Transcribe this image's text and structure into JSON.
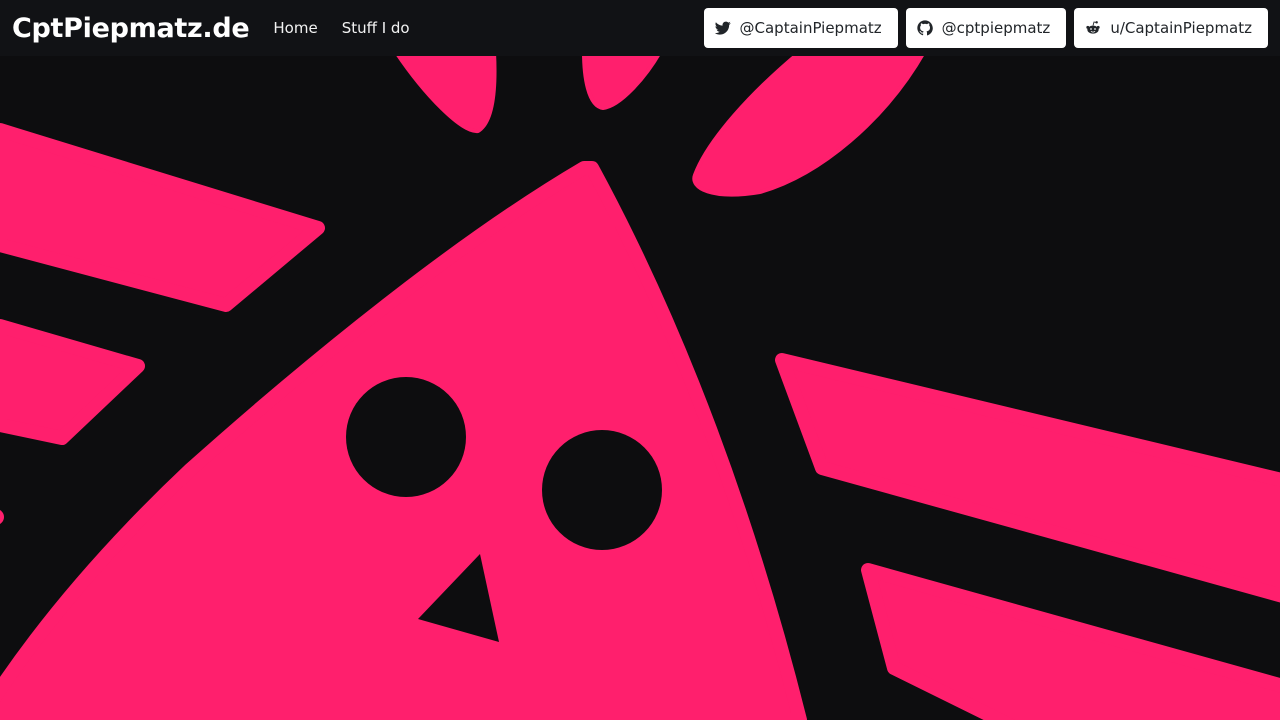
{
  "navbar": {
    "brand": "CptPiepmatz.de",
    "links": [
      {
        "label": "Home"
      },
      {
        "label": "Stuff I do"
      }
    ]
  },
  "social": [
    {
      "icon": "twitter-icon",
      "label": "@CaptainPiepmatz"
    },
    {
      "icon": "github-icon",
      "label": "@cptpiepmatz"
    },
    {
      "icon": "reddit-icon",
      "label": "u/CaptainPiepmatz"
    }
  ],
  "colors": {
    "accent": "#ff1f6d",
    "background": "#0d0d0f",
    "navbar": "#111215"
  }
}
